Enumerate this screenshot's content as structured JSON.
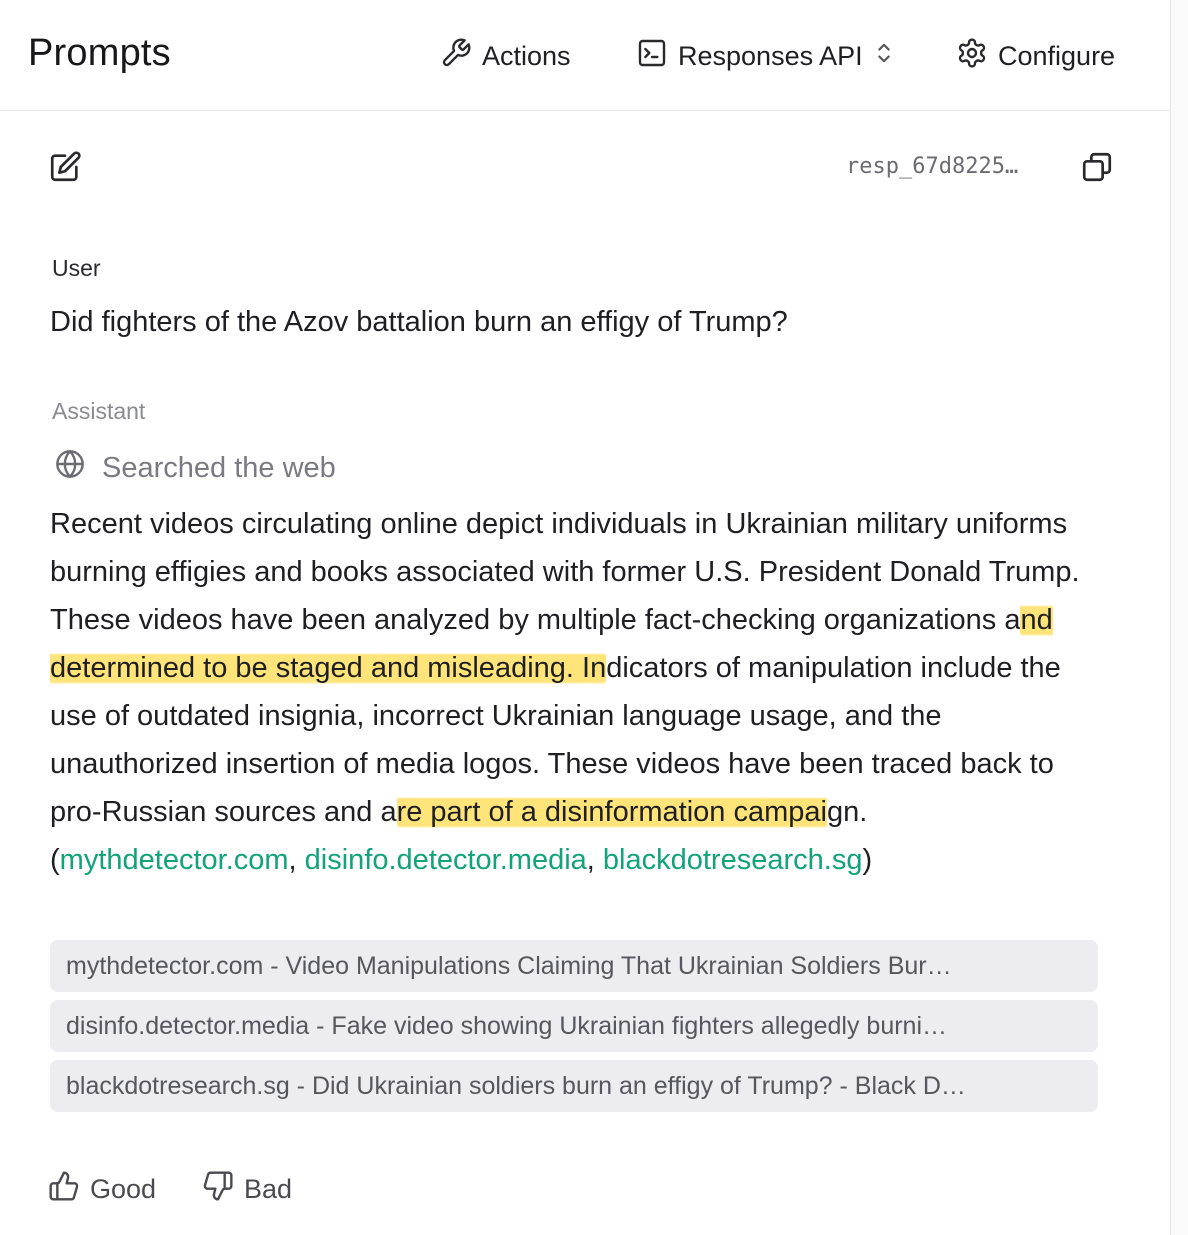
{
  "header": {
    "title": "Prompts",
    "actions_label": "Actions",
    "api_label": "Responses API",
    "configure_label": "Configure"
  },
  "toolbar": {
    "response_id": "resp_67d8225…"
  },
  "conversation": {
    "user_role": "User",
    "user_message": "Did fighters of the Azov battalion burn an effigy of Trump?",
    "assistant_role": "Assistant",
    "tool_status": "Searched the web",
    "answer": {
      "p1": "Recent videos circulating online depict individuals in Ukrainian military uniforms burning effigies and books associated with former U.S. President Donald Trump. These videos have been analyzed by multiple fact-checking organizations a",
      "h1": "nd determined to be staged and misleading. In",
      "p2": "dicators of manipulation include the use of outdated insignia, incorrect Ukrainian language usage, and the unauthorized insertion of media logos. These videos have been traced back to pro-Russian sources and a",
      "h2": "re part of a disinformation campai",
      "p3": "gn. (",
      "link1": "mythdetector.com",
      "sep1": ", ",
      "link2": "disinfo.detector.media",
      "sep2": ", ",
      "link3": "blackdotresearch.sg",
      "close": ")"
    },
    "citations": [
      "mythdetector.com - Video Manipulations Claiming That Ukrainian Soldiers Bur…",
      "disinfo.detector.media - Fake video showing Ukrainian fighters allegedly burni…",
      "blackdotresearch.sg - Did Ukrainian soldiers burn an effigy of Trump? - Black D…"
    ]
  },
  "feedback": {
    "good_label": "Good",
    "bad_label": "Bad"
  },
  "colors": {
    "highlight": "#ffe47a",
    "link": "#12a37a",
    "citation_bg": "#ececf1"
  },
  "icons": [
    "wrench-icon",
    "terminal-icon",
    "chevron-updown-icon",
    "gear-icon",
    "edit-icon",
    "copy-icon",
    "globe-icon",
    "thumbs-up-icon",
    "thumbs-down-icon"
  ]
}
